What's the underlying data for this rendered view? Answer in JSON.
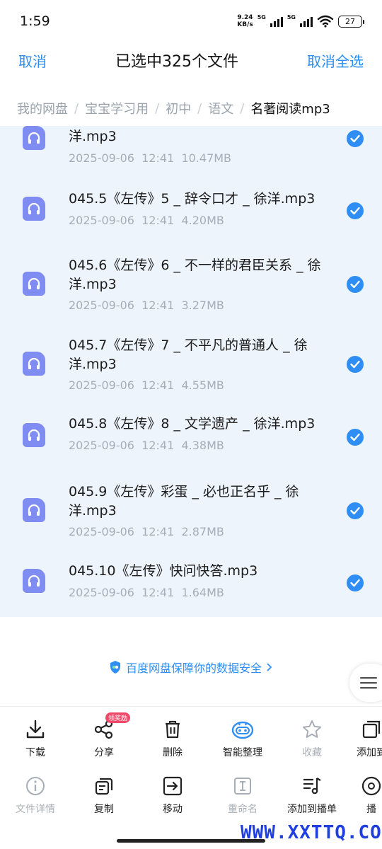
{
  "status": {
    "time": "1:59",
    "net_speed_value": "9.24",
    "net_speed_unit": "KB/s",
    "sig1_tag": "5G",
    "sig2_tag": "5G",
    "battery": "27"
  },
  "header": {
    "cancel": "取消",
    "title": "已选中325个文件",
    "deselect_all": "取消全选"
  },
  "breadcrumb": [
    "我的网盘",
    "宝宝学习用",
    "初中",
    "语文",
    "名著阅读mp3"
  ],
  "breadcrumb_sep": "/",
  "files": [
    {
      "name": "洋.mp3",
      "meta": "2025-09-06  12:41  10.47MB",
      "checked": true
    },
    {
      "name": "045.5《左传》5 _ 辞令口才 _ 徐洋.mp3",
      "meta": "2025-09-06  12:41  4.20MB",
      "checked": true
    },
    {
      "name": "045.6《左传》6 _ 不一样的君臣关系 _ 徐洋.mp3",
      "meta": "2025-09-06  12:41  3.27MB",
      "checked": true
    },
    {
      "name": "045.7《左传》7 _ 不平凡的普通人 _ 徐洋.mp3",
      "meta": "2025-09-06  12:41  4.55MB",
      "checked": true
    },
    {
      "name": "045.8《左传》8 _ 文学遗产 _ 徐洋.mp3",
      "meta": "2025-09-06  12:41  4.38MB",
      "checked": true
    },
    {
      "name": "045.9《左传》彩蛋 _ 必也正名乎 _ 徐洋.mp3",
      "meta": "2025-09-06  12:41  2.87MB",
      "checked": true
    },
    {
      "name": "045.10《左传》快问快答.mp3",
      "meta": "2025-09-06  12:41  1.64MB",
      "checked": true
    }
  ],
  "security_text": "百度网盘保障你的数据安全",
  "toolbar": {
    "row1": [
      {
        "label": "下载",
        "icon": "download-icon",
        "disabled": false
      },
      {
        "label": "分享",
        "icon": "share-icon",
        "disabled": false,
        "badge": "领奖励"
      },
      {
        "label": "删除",
        "icon": "trash-icon",
        "disabled": false
      },
      {
        "label": "智能整理",
        "icon": "robot-icon",
        "disabled": false
      },
      {
        "label": "收藏",
        "icon": "star-icon",
        "disabled": true
      },
      {
        "label": "添加到",
        "icon": "add-to-icon",
        "disabled": false
      }
    ],
    "row2": [
      {
        "label": "文件详情",
        "icon": "info-icon",
        "disabled": true
      },
      {
        "label": "复制",
        "icon": "copy-icon",
        "disabled": false
      },
      {
        "label": "移动",
        "icon": "move-icon",
        "disabled": false
      },
      {
        "label": "重命名",
        "icon": "rename-icon",
        "disabled": true
      },
      {
        "label": "添加到播单",
        "icon": "playlist-add-icon",
        "disabled": false
      },
      {
        "label": "播",
        "icon": "play-icon",
        "disabled": false
      }
    ]
  },
  "watermark": "WWW.XXTTQ.COM",
  "colors": {
    "accent": "#2f8ef5",
    "file_icon": "#7f8cf2",
    "list_bg": "#eef4fb"
  }
}
